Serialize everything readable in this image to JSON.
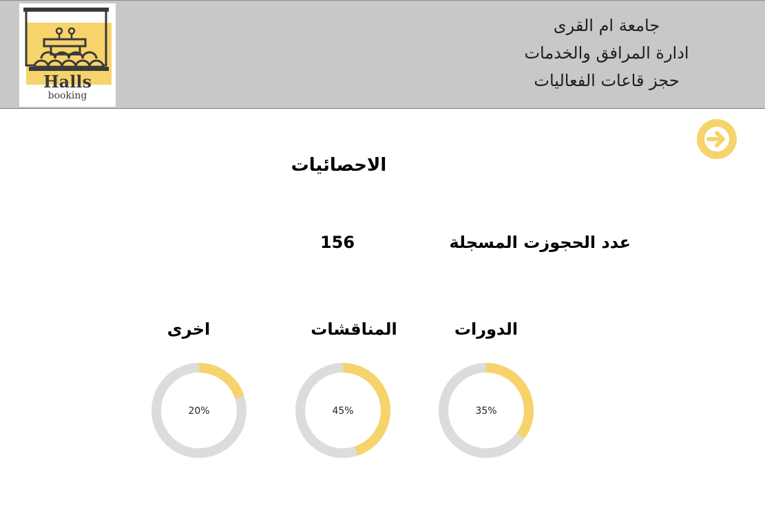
{
  "header": {
    "logo": {
      "title": "Halls",
      "subtitle": "booking"
    },
    "line1": "جامعة ام القرى",
    "line2": "ادارة المرافق والخدمات",
    "line3": "حجز قاعات الفعاليات"
  },
  "page": {
    "title": "الاحصائيات",
    "bookings_label": "عدد الحجوزت المسجلة",
    "bookings_count": "156"
  },
  "colors": {
    "accent": "#F7D36B",
    "track": "#DCDCDC",
    "header_bg": "#C8C8C8"
  },
  "stats": [
    {
      "label": "الدورات",
      "percent": 35,
      "text": "35%"
    },
    {
      "label": "المناقشات",
      "percent": 45,
      "text": "45%"
    },
    {
      "label": "اخرى",
      "percent": 20,
      "text": "20%"
    }
  ],
  "icons": {
    "back": "arrow-right-circle-icon",
    "logo": "podium-audience-icon"
  }
}
